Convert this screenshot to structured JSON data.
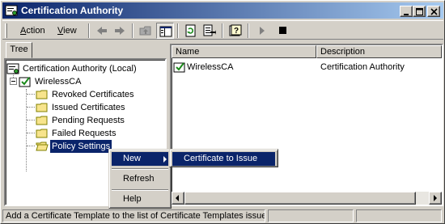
{
  "window": {
    "title": "Certification Authority",
    "title_gradient_start": "#0a246a",
    "title_gradient_end": "#a6caf0",
    "controls": [
      "minimize-icon",
      "maximize-icon",
      "close-icon"
    ]
  },
  "toolbar": {
    "action_label": "Action",
    "action_underline": "A",
    "action_rest": "ction",
    "view_label": "View",
    "view_underline": "V",
    "view_rest": "iew",
    "buttons": [
      "back-icon",
      "forward-icon",
      "up-folder-icon",
      "show-hide-tree-icon",
      "refresh-icon",
      "export-list-icon",
      "help-icon",
      "start-service-icon",
      "stop-service-icon"
    ]
  },
  "tree": {
    "tab_label": "Tree",
    "root": "Certification Authority (Local)",
    "ca_name": "WirelessCA",
    "folders": [
      "Revoked Certificates",
      "Issued Certificates",
      "Pending Requests",
      "Failed Requests",
      "Policy Settings"
    ],
    "selected": "Policy Settings"
  },
  "list": {
    "columns": [
      "Name",
      "Description"
    ],
    "rows": [
      {
        "name": "WirelessCA",
        "description": "Certification Authority"
      }
    ]
  },
  "context_menu": {
    "items": [
      "New",
      "Refresh",
      "Help"
    ],
    "highlighted": "New",
    "submenu_items": [
      "Certificate to Issue"
    ]
  },
  "status": {
    "message": "Add a Certificate Template to the list of Certificate Templates issue"
  },
  "colors": {
    "face": "#d4d0c8",
    "selection": "#0a246a",
    "folder": "#f7e48c"
  }
}
